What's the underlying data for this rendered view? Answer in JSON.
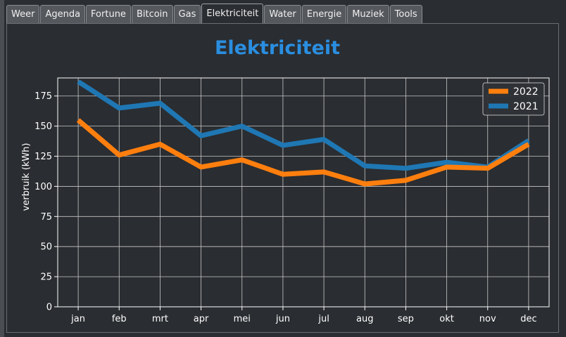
{
  "tabs": [
    {
      "label": "Weer",
      "active": false
    },
    {
      "label": "Agenda",
      "active": false
    },
    {
      "label": "Fortune",
      "active": false
    },
    {
      "label": "Bitcoin",
      "active": false
    },
    {
      "label": "Gas",
      "active": false
    },
    {
      "label": "Elektriciteit",
      "active": true
    },
    {
      "label": "Water",
      "active": false
    },
    {
      "label": "Energie",
      "active": false
    },
    {
      "label": "Muziek",
      "active": false
    },
    {
      "label": "Tools",
      "active": false
    }
  ],
  "colors": {
    "title": "#2a8ee0",
    "series_2022": "#ff7f0e",
    "series_2021": "#1f77b4",
    "axes_text": "#ffffff",
    "grid": "#c8c8c8"
  },
  "chart_data": {
    "type": "line",
    "title": "Elektriciteit",
    "xlabel": "",
    "ylabel": "verbruik (kWh)",
    "categories": [
      "jan",
      "feb",
      "mrt",
      "apr",
      "mei",
      "jun",
      "jul",
      "aug",
      "sep",
      "okt",
      "nov",
      "dec"
    ],
    "ylim": [
      0,
      190
    ],
    "yticks": [
      0,
      25,
      50,
      75,
      100,
      125,
      150,
      175
    ],
    "grid": true,
    "legend_position": "top-right",
    "series": [
      {
        "name": "2022",
        "values": [
          155,
          126,
          135,
          116,
          122,
          110,
          112,
          102,
          105,
          116,
          115,
          135
        ]
      },
      {
        "name": "2021",
        "values": [
          187,
          165,
          169,
          142,
          150,
          134,
          139,
          117,
          115,
          120,
          116,
          138
        ]
      }
    ]
  }
}
